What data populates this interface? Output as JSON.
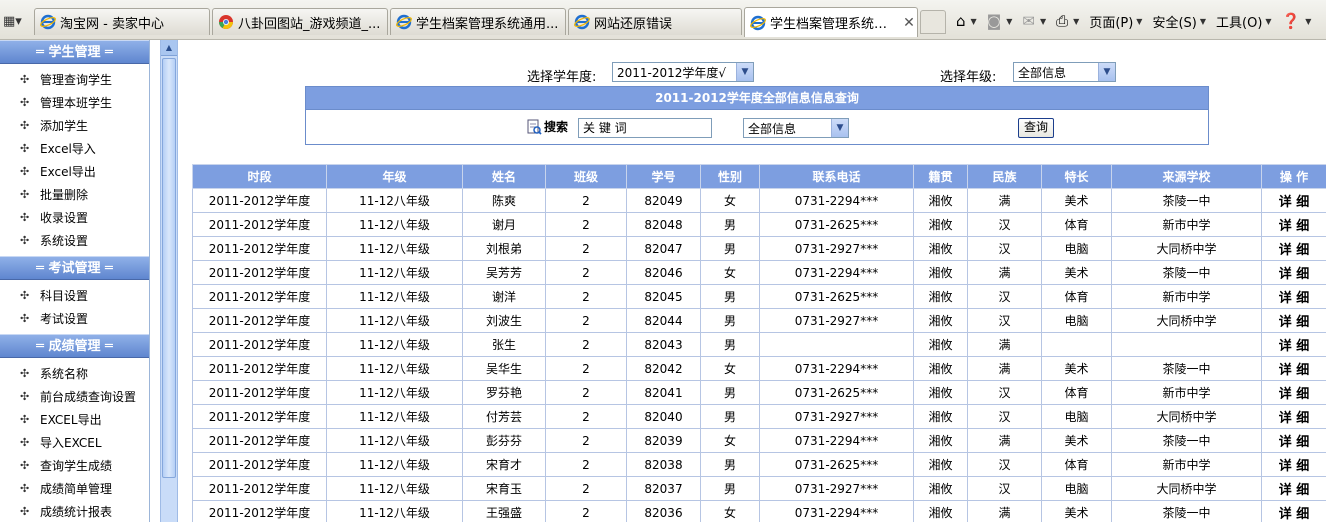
{
  "browser": {
    "tabs": [
      {
        "title": "淘宝网 - 卖家中心",
        "active": false
      },
      {
        "title": "八卦回图站_游戏频道_...",
        "active": false
      },
      {
        "title": "学生档案管理系统通用...",
        "active": false
      },
      {
        "title": "网站还原错误",
        "active": false
      },
      {
        "title": "学生档案管理系统通...",
        "active": true
      }
    ],
    "close_glyph": "✕",
    "commands": {
      "page": "页面(P)",
      "safety": "安全(S)",
      "tools": "工具(O)"
    }
  },
  "sidebar": {
    "sections": [
      {
        "title": "═ 学生管理 ═",
        "items": [
          "管理查询学生",
          "管理本班学生",
          "添加学生",
          "Excel导入",
          "Excel导出",
          "批量删除",
          "收录设置",
          "系统设置"
        ]
      },
      {
        "title": "═ 考试管理 ═",
        "items": [
          "科目设置",
          "考试设置"
        ]
      },
      {
        "title": "═ 成绩管理 ═",
        "items": [
          "系统名称",
          "前台成绩查询设置",
          "EXCEL导出",
          "导入EXCEL",
          "查询学生成绩",
          "成绩简单管理",
          "成绩统计报表"
        ]
      }
    ]
  },
  "filters": {
    "year_label": "选择学年度:",
    "year_value": "2011-2012学年度√",
    "grade_label": "选择年级:",
    "grade_value": "全部信息"
  },
  "search": {
    "title": "2011-2012学年度全部信息信息查询",
    "label": "搜索",
    "keyword": "关 键 词",
    "scope_value": "全部信息",
    "button": "查询"
  },
  "table": {
    "headers": [
      "时段",
      "年级",
      "姓名",
      "班级",
      "学号",
      "性别",
      "联系电话",
      "籍贯",
      "民族",
      "特长",
      "来源学校",
      "操 作"
    ],
    "rows": [
      [
        "2011-2012学年度",
        "11-12八年级",
        "陈爽",
        "2",
        "82049",
        "女",
        "0731-2294***",
        "湘攸",
        "满",
        "美术",
        "茶陵一中",
        "详 细"
      ],
      [
        "2011-2012学年度",
        "11-12八年级",
        "谢月",
        "2",
        "82048",
        "男",
        "0731-2625***",
        "湘攸",
        "汉",
        "体育",
        "新市中学",
        "详 细"
      ],
      [
        "2011-2012学年度",
        "11-12八年级",
        "刘根弟",
        "2",
        "82047",
        "男",
        "0731-2927***",
        "湘攸",
        "汉",
        "电脑",
        "大同桥中学",
        "详 细"
      ],
      [
        "2011-2012学年度",
        "11-12八年级",
        "吴芳芳",
        "2",
        "82046",
        "女",
        "0731-2294***",
        "湘攸",
        "满",
        "美术",
        "茶陵一中",
        "详 细"
      ],
      [
        "2011-2012学年度",
        "11-12八年级",
        "谢洋",
        "2",
        "82045",
        "男",
        "0731-2625***",
        "湘攸",
        "汉",
        "体育",
        "新市中学",
        "详 细"
      ],
      [
        "2011-2012学年度",
        "11-12八年级",
        "刘波生",
        "2",
        "82044",
        "男",
        "0731-2927***",
        "湘攸",
        "汉",
        "电脑",
        "大同桥中学",
        "详 细"
      ],
      [
        "2011-2012学年度",
        "11-12八年级",
        "张生",
        "2",
        "82043",
        "男",
        "",
        "湘攸",
        "满",
        "",
        "",
        "详 细"
      ],
      [
        "2011-2012学年度",
        "11-12八年级",
        "吴华生",
        "2",
        "82042",
        "女",
        "0731-2294***",
        "湘攸",
        "满",
        "美术",
        "茶陵一中",
        "详 细"
      ],
      [
        "2011-2012学年度",
        "11-12八年级",
        "罗芬艳",
        "2",
        "82041",
        "男",
        "0731-2625***",
        "湘攸",
        "汉",
        "体育",
        "新市中学",
        "详 细"
      ],
      [
        "2011-2012学年度",
        "11-12八年级",
        "付芳芸",
        "2",
        "82040",
        "男",
        "0731-2927***",
        "湘攸",
        "汉",
        "电脑",
        "大同桥中学",
        "详 细"
      ],
      [
        "2011-2012学年度",
        "11-12八年级",
        "彭芬芬",
        "2",
        "82039",
        "女",
        "0731-2294***",
        "湘攸",
        "满",
        "美术",
        "茶陵一中",
        "详 细"
      ],
      [
        "2011-2012学年度",
        "11-12八年级",
        "宋育才",
        "2",
        "82038",
        "男",
        "0731-2625***",
        "湘攸",
        "汉",
        "体育",
        "新市中学",
        "详 细"
      ],
      [
        "2011-2012学年度",
        "11-12八年级",
        "宋育玉",
        "2",
        "82037",
        "男",
        "0731-2927***",
        "湘攸",
        "汉",
        "电脑",
        "大同桥中学",
        "详 细"
      ],
      [
        "2011-2012学年度",
        "11-12八年级",
        "王强盛",
        "2",
        "82036",
        "女",
        "0731-2294***",
        "湘攸",
        "满",
        "美术",
        "茶陵一中",
        "详 细"
      ]
    ]
  },
  "colors": {
    "header_blue": "#7d9ee0",
    "sidebar_head": "#6f93d8",
    "scroll": "#c9dcf8"
  }
}
